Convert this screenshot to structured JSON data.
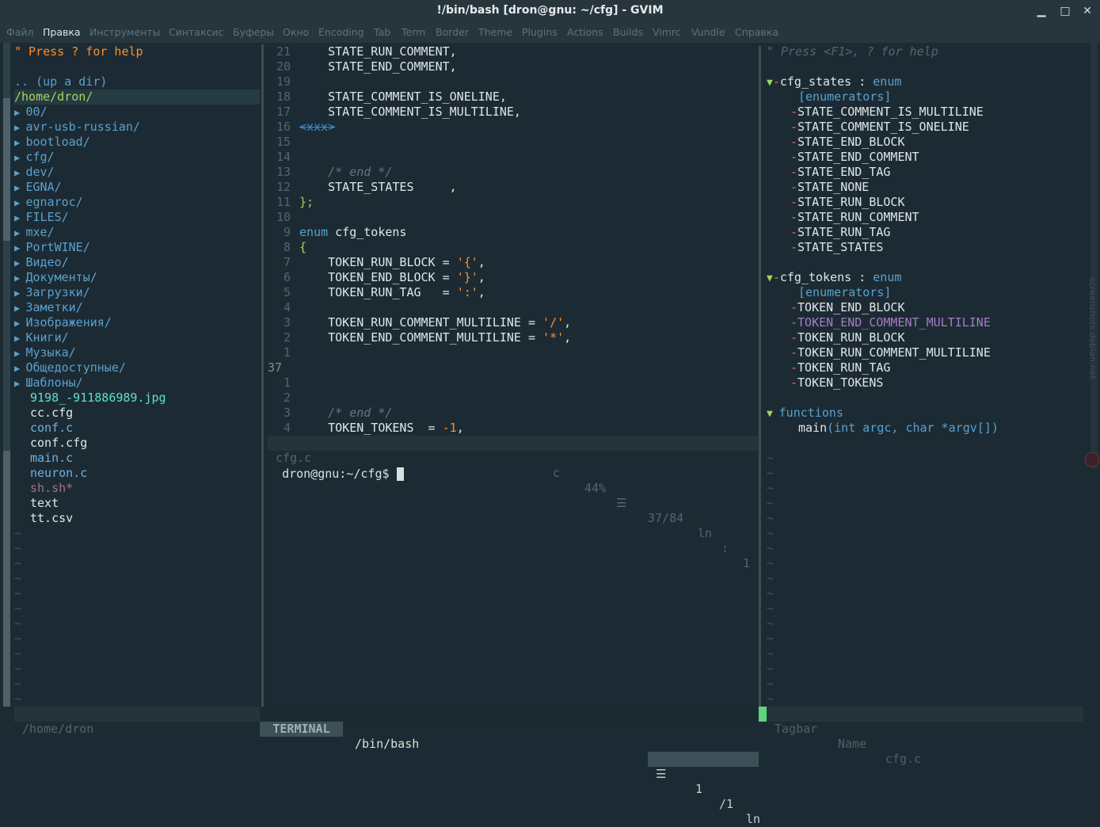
{
  "window": {
    "title": "!/bin/bash [dron@gnu: ~/cfg] - GVIM",
    "minimize_glyph": "▁",
    "maximize_glyph": "□",
    "close_glyph": "✕"
  },
  "menu": [
    "Файл",
    "Правка",
    "Инструменты",
    "Синтаксис",
    "Буферы",
    "Окно",
    "Encoding",
    "Tab",
    "Term",
    "Border",
    "Theme",
    "Plugins",
    "Actions",
    "Builds",
    "Vimrc",
    "Vundle",
    "Справка"
  ],
  "nerdtree": {
    "help": "\" Press ? for help",
    "updir": ".. (up a dir)",
    "root": "/home/dron/",
    "dirs": [
      "00/",
      "avr-usb-russian/",
      "bootload/",
      "cfg/",
      "dev/",
      "EGNA/",
      "egnaroc/",
      "FILES/",
      "mxe/",
      "PortWINE/",
      "Видео/",
      "Документы/",
      "Загрузки/",
      "Заметки/",
      "Изображения/",
      "Книги/",
      "Музыка/",
      "Общедоступные/",
      "Шаблоны/"
    ],
    "files": [
      {
        "name": "9198_-911886989.jpg",
        "kind": "image"
      },
      {
        "name": "cc.cfg",
        "kind": "plain"
      },
      {
        "name": "conf.c",
        "kind": "csrc"
      },
      {
        "name": "conf.cfg",
        "kind": "plain"
      },
      {
        "name": "main.c",
        "kind": "csrc"
      },
      {
        "name": "neuron.c",
        "kind": "csrc"
      },
      {
        "name": "sh.sh*",
        "kind": "exec"
      },
      {
        "name": "text",
        "kind": "plain"
      },
      {
        "name": "tt.csv",
        "kind": "plain"
      }
    ],
    "tilde": "~",
    "status": "/home/dron"
  },
  "editor": {
    "lines": [
      {
        "num": "21",
        "tokens": [
          [
            "    STATE_RUN_COMMENT,",
            "id"
          ]
        ]
      },
      {
        "num": "20",
        "tokens": [
          [
            "    STATE_END_COMMENT,",
            "id"
          ]
        ]
      },
      {
        "num": "19",
        "tokens": []
      },
      {
        "num": "18",
        "tokens": [
          [
            "    STATE_COMMENT_IS_ONELINE,",
            "id"
          ]
        ]
      },
      {
        "num": "17",
        "tokens": [
          [
            "    STATE_COMMENT_IS_MULTILINE,",
            "id"
          ]
        ]
      },
      {
        "num": "16",
        "tokens": [
          [
            "<xxx>",
            "ws"
          ]
        ]
      },
      {
        "num": "15",
        "tokens": []
      },
      {
        "num": "14",
        "tokens": []
      },
      {
        "num": "13",
        "tokens": [
          [
            "    ",
            "id"
          ],
          [
            "/* end */",
            "com"
          ]
        ]
      },
      {
        "num": "12",
        "tokens": [
          [
            "    STATE_STATES     ,",
            "id"
          ]
        ]
      },
      {
        "num": "11",
        "tokens": [
          [
            "};",
            "punc"
          ]
        ]
      },
      {
        "num": "10",
        "tokens": []
      },
      {
        "num": "9",
        "tokens": [
          [
            "enum",
            "kw"
          ],
          [
            " cfg_tokens",
            "id"
          ]
        ]
      },
      {
        "num": "8",
        "tokens": [
          [
            "{",
            "punc"
          ]
        ]
      },
      {
        "num": "7",
        "tokens": [
          [
            "    TOKEN_RUN_BLOCK = ",
            "id"
          ],
          [
            "'{'",
            "str"
          ],
          [
            ",",
            "id"
          ]
        ]
      },
      {
        "num": "6",
        "tokens": [
          [
            "    TOKEN_END_BLOCK = ",
            "id"
          ],
          [
            "'}'",
            "str"
          ],
          [
            ",",
            "id"
          ]
        ]
      },
      {
        "num": "5",
        "tokens": [
          [
            "    TOKEN_RUN_TAG   = ",
            "id"
          ],
          [
            "':'",
            "str"
          ],
          [
            ",",
            "id"
          ]
        ]
      },
      {
        "num": "4",
        "tokens": []
      },
      {
        "num": "3",
        "tokens": [
          [
            "    TOKEN_RUN_COMMENT_MULTILINE = ",
            "id"
          ],
          [
            "'/'",
            "str"
          ],
          [
            ",",
            "id"
          ]
        ]
      },
      {
        "num": "2",
        "tokens": [
          [
            "    TOKEN_END_COMMENT_MULTILINE = ",
            "id"
          ],
          [
            "'*'",
            "str"
          ],
          [
            ",",
            "id"
          ]
        ]
      },
      {
        "num": "1",
        "tokens": []
      },
      {
        "num": "37",
        "tokens": [],
        "current": true
      },
      {
        "num": "1",
        "tokens": []
      },
      {
        "num": "2",
        "tokens": []
      },
      {
        "num": "3",
        "tokens": [
          [
            "    ",
            "id"
          ],
          [
            "/* end */",
            "com"
          ]
        ]
      },
      {
        "num": "4",
        "tokens": [
          [
            "    TOKEN_TOKENS  = ",
            "id"
          ],
          [
            "-1",
            "num"
          ],
          [
            ",",
            "id"
          ]
        ]
      }
    ],
    "status": {
      "file": "cfg.c",
      "ft": "c",
      "percent": "44%",
      "menu_glyph": "☰",
      "pos": "37/84",
      "ln": "ln",
      "colon": ":",
      "col": "1"
    }
  },
  "terminal": {
    "prompt": "dron@gnu:~/cfg$ ",
    "status": {
      "mode": "TERMINAL",
      "name": "/bin/bash",
      "menu_glyph": "☰",
      "line": "1",
      "total": "/1",
      "ln": "ln"
    }
  },
  "tagbar": {
    "help": "\" Press <F1>, ? for help",
    "groups": [
      {
        "name": "cfg_states",
        "sep": " : ",
        "type": "enum",
        "sub": "[enumerators]",
        "items": [
          "STATE_COMMENT_IS_MULTILINE",
          "STATE_COMMENT_IS_ONELINE",
          "STATE_END_BLOCK",
          "STATE_END_COMMENT",
          "STATE_END_TAG",
          "STATE_NONE",
          "STATE_RUN_BLOCK",
          "STATE_RUN_COMMENT",
          "STATE_RUN_TAG",
          "STATE_STATES"
        ]
      },
      {
        "name": "cfg_tokens",
        "sep": " : ",
        "type": "enum",
        "sub": "[enumerators]",
        "items": [
          "TOKEN_END_BLOCK",
          "TOKEN_END_COMMENT_MULTILINE",
          "TOKEN_RUN_BLOCK",
          "TOKEN_RUN_COMMENT_MULTILINE",
          "TOKEN_RUN_TAG",
          "TOKEN_TOKENS"
        ],
        "highlight": 1
      }
    ],
    "functions_label": "functions",
    "function": {
      "name": "main",
      "args": "(int argc, char *argv[])"
    },
    "status": {
      "a": "Tagbar",
      "b": "Name",
      "c": "cfg.c"
    }
  },
  "watermark": "screenshots.debian.net"
}
